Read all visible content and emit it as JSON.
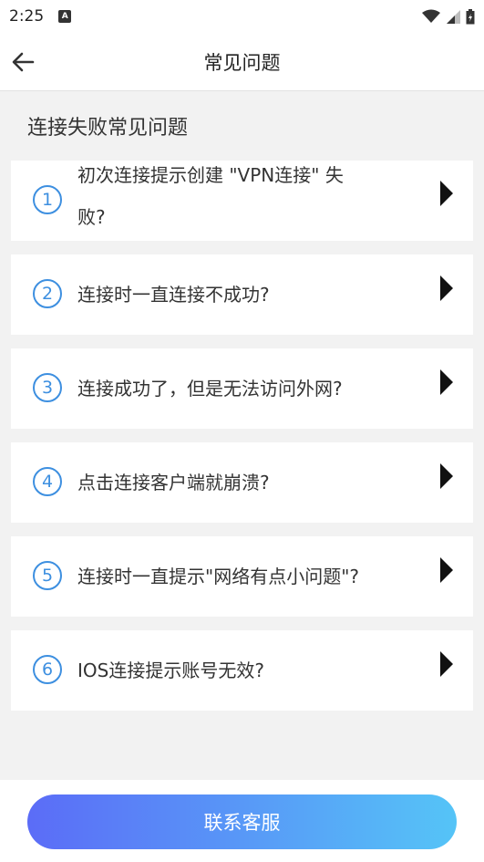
{
  "status_bar": {
    "time": "2:25",
    "notification_letter": "A"
  },
  "header": {
    "title": "常见问题"
  },
  "section": {
    "title": "连接失败常见问题"
  },
  "faq_items": [
    {
      "number": "1",
      "line1": "初次连接提示创建 \"VPN连接\" 失",
      "line2": "败?"
    },
    {
      "number": "2",
      "text": "连接时一直连接不成功?"
    },
    {
      "number": "3",
      "text": "连接成功了，但是无法访问外网?"
    },
    {
      "number": "4",
      "text": "点击连接客户端就崩溃?"
    },
    {
      "number": "5",
      "text": "连接时一直提示\"网络有点小问题\"?"
    },
    {
      "number": "6",
      "text": "IOS连接提示账号无效?"
    }
  ],
  "footer": {
    "contact_button_label": "联系客服"
  },
  "colors": {
    "accent": "#3d8fe0",
    "gradient_start": "#5b6cf7",
    "gradient_end": "#55c4f7"
  },
  "icons": {
    "back": "arrow-left-icon",
    "row_arrow": "triangle-right-icon"
  }
}
